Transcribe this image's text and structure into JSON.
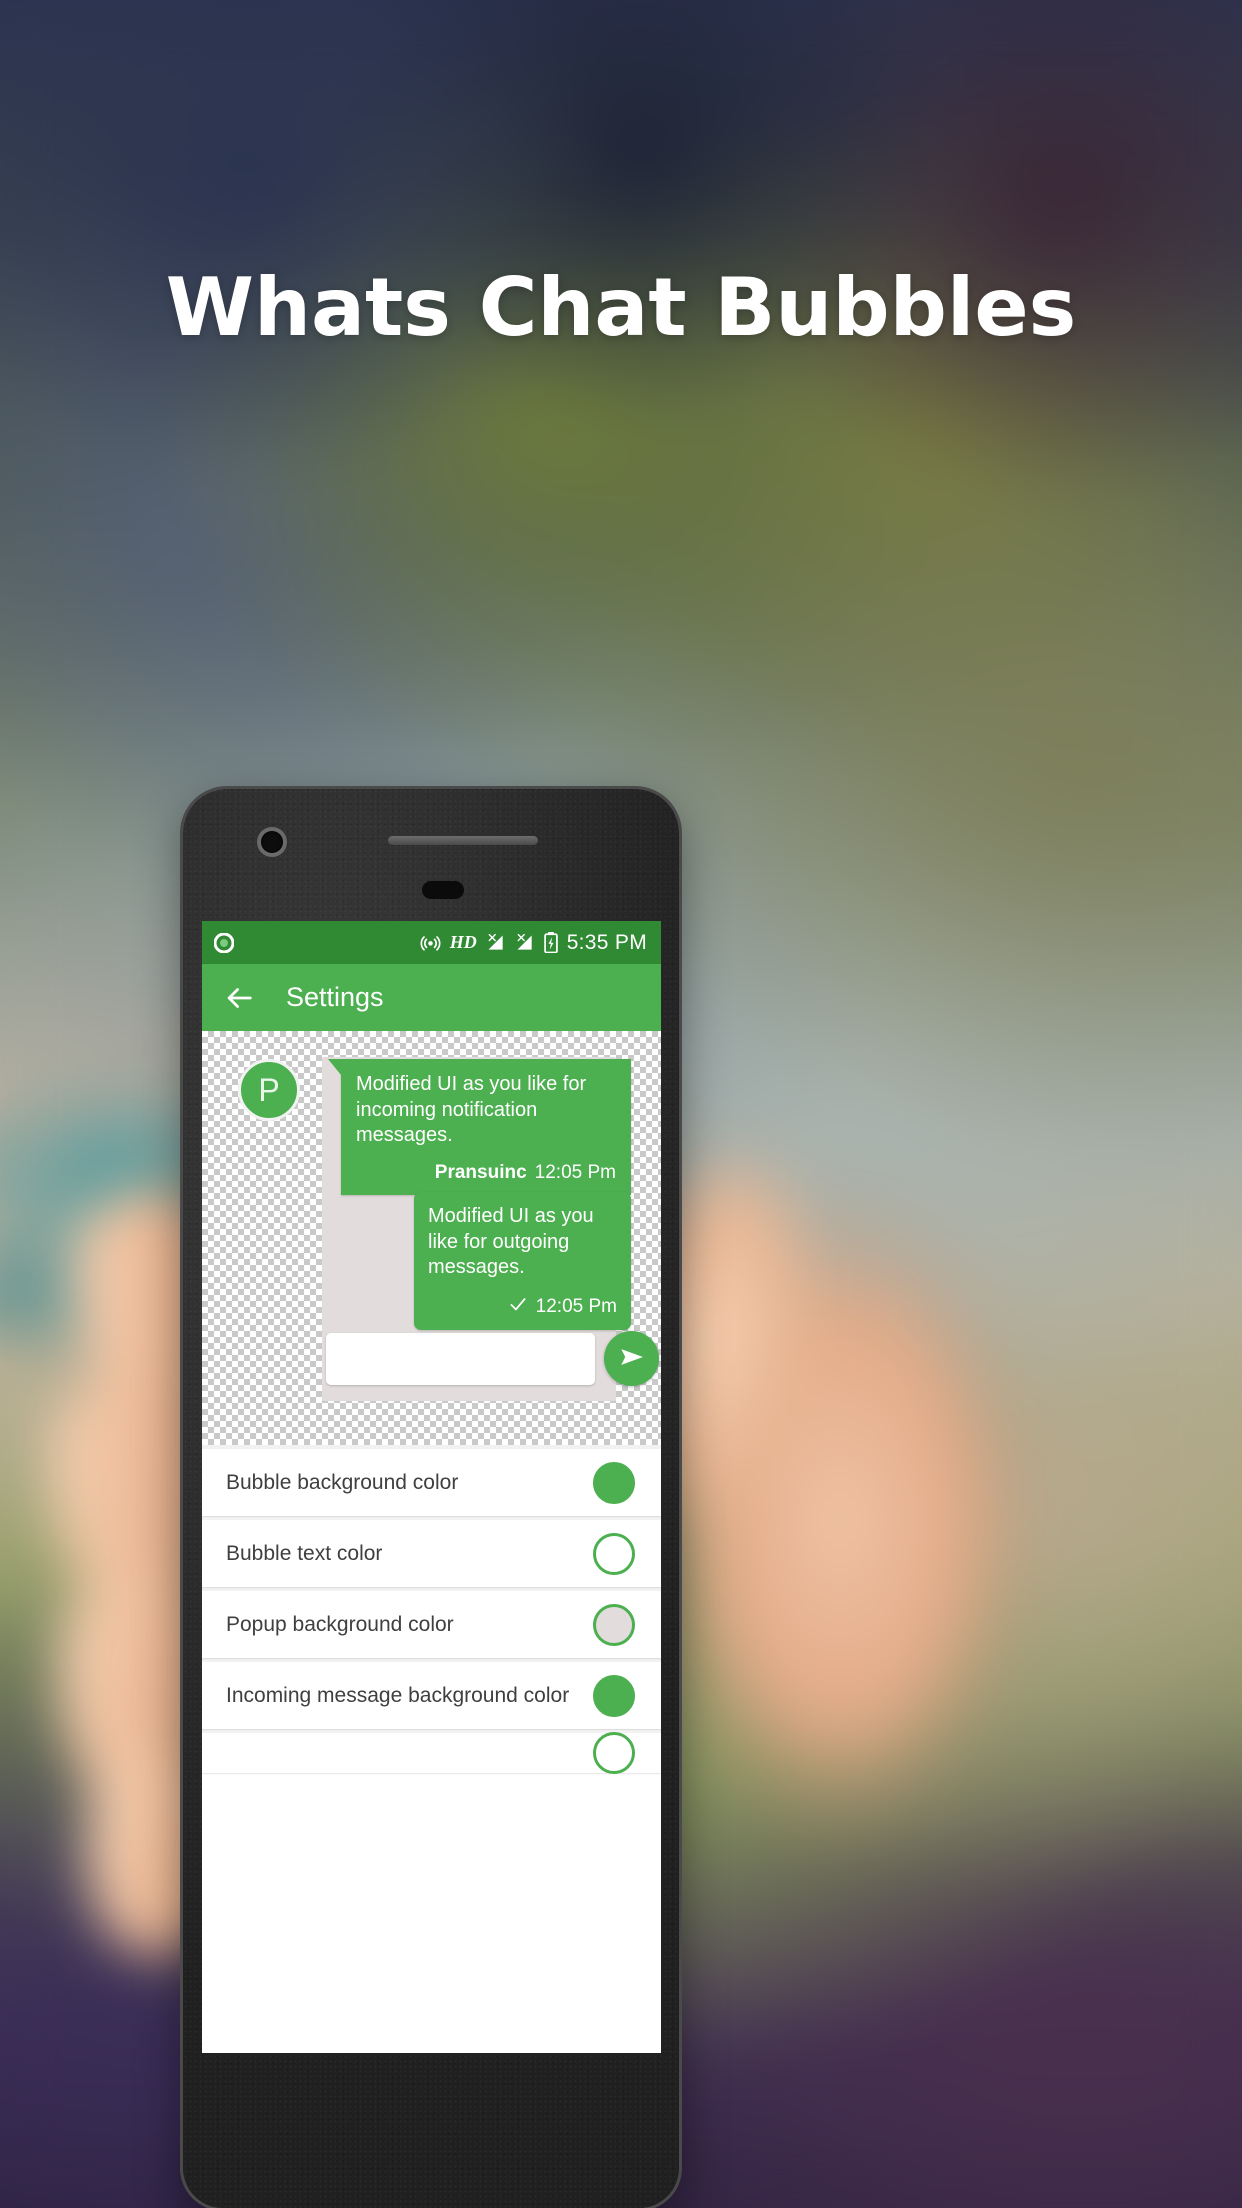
{
  "headline": "Whats Chat Bubbles",
  "status_bar": {
    "time": "5:35 PM",
    "hd_label": "HD",
    "icons": [
      "record-icon",
      "hotspot-icon",
      "signal-off-icon",
      "signal-off-icon",
      "battery-charging-icon"
    ]
  },
  "toolbar": {
    "back_icon": "back-arrow-icon",
    "title": "Settings"
  },
  "preview": {
    "avatar_initial": "P",
    "incoming_message": {
      "text": "Modified UI as you like for incoming notification messages.",
      "sender": "Pransuinc",
      "time": "12:05 Pm"
    },
    "outgoing_message": {
      "text": "Modified UI as you like for outgoing messages.",
      "time": "12:05 Pm",
      "status_icon": "check-icon"
    },
    "input_placeholder": "",
    "input_value": "",
    "send_icon": "send-icon"
  },
  "settings": {
    "rows": [
      {
        "label": "Bubble background color",
        "swatch_fill": "#4caf50",
        "swatch_border": "#4caf50"
      },
      {
        "label": "Bubble text color",
        "swatch_fill": "#ffffff",
        "swatch_border": "#4caf50"
      },
      {
        "label": "Popup background color",
        "swatch_fill": "#e2dcdc",
        "swatch_border": "#4caf50"
      },
      {
        "label": "Incoming message background color",
        "swatch_fill": "#4caf50",
        "swatch_border": "#4caf50"
      },
      {
        "label": "",
        "swatch_fill": "#ffffff",
        "swatch_border": "#4caf50"
      }
    ]
  },
  "colors": {
    "brand_green": "#4caf50",
    "status_bar_green": "#2f8a33",
    "popup_gray": "#e2dcdc",
    "text_dark": "#3f3f3f"
  }
}
